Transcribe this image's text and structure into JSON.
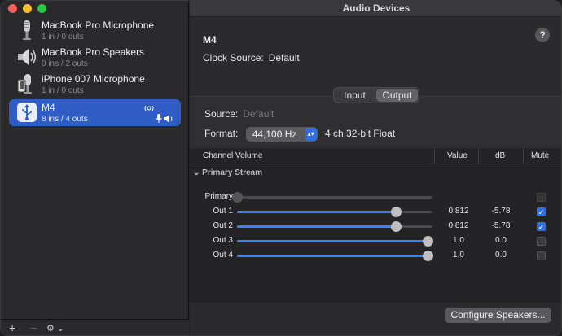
{
  "window": {
    "title": "Audio Devices"
  },
  "sidebar": {
    "devices": [
      {
        "name": "MacBook Pro Microphone",
        "sub": "1 in / 0 outs",
        "icon": "microphone-icon"
      },
      {
        "name": "MacBook Pro Speakers",
        "sub": "0 ins / 2 outs",
        "icon": "speaker-icon"
      },
      {
        "name": "iPhone 007 Microphone",
        "sub": "1 in / 0 outs",
        "icon": "iphone-microphone-icon"
      },
      {
        "name": "M4",
        "sub": "8 ins / 4 outs",
        "icon": "usb-icon",
        "selected": true
      }
    ],
    "footer": {
      "add": "+",
      "remove": "−",
      "settings": "⚙︎ ⌄"
    }
  },
  "detail": {
    "device_name": "M4",
    "clock_source_label": "Clock Source:",
    "clock_source_value": "Default",
    "help": "?",
    "tabs": {
      "input": "Input",
      "output": "Output",
      "selected": "Output"
    },
    "source_label": "Source:",
    "source_value": "Default",
    "format_label": "Format:",
    "format_value": "44,100 Hz",
    "format_desc": "4 ch 32-bit Float"
  },
  "table": {
    "headers": {
      "channel": "Channel Volume",
      "value": "Value",
      "db": "dB",
      "mute": "Mute"
    },
    "stream": "Primary Stream",
    "rows": [
      {
        "label": "Primary",
        "level": 0.0,
        "value": "",
        "db": "",
        "mute": false,
        "disabled": true
      },
      {
        "label": "Out 1",
        "level": 0.812,
        "value": "0.812",
        "db": "-5.78",
        "mute": true,
        "disabled": false
      },
      {
        "label": "Out 2",
        "level": 0.812,
        "value": "0.812",
        "db": "-5.78",
        "mute": true,
        "disabled": false
      },
      {
        "label": "Out 3",
        "level": 1.0,
        "value": "1.0",
        "db": "0.0",
        "mute": false,
        "disabled": false
      },
      {
        "label": "Out 4",
        "level": 1.0,
        "value": "1.0",
        "db": "0.0",
        "mute": false,
        "disabled": false
      }
    ]
  },
  "footer": {
    "configure": "Configure Speakers..."
  },
  "colors": {
    "accent": "#2f6fe0",
    "selection": "#2f5dc5",
    "slider_fill": "#3a82f7"
  }
}
